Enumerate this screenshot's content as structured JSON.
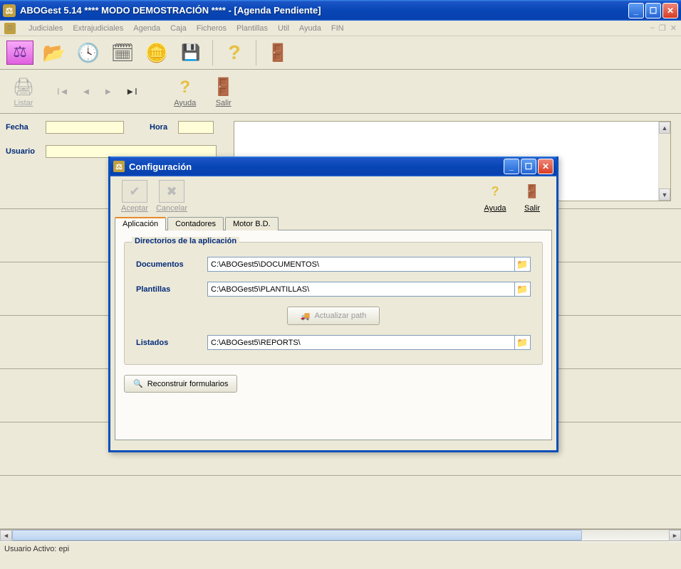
{
  "window": {
    "title": "ABOGest 5.14 **** MODO DEMOSTRACIÓN ****  - [Agenda Pendiente]"
  },
  "menu": {
    "items": [
      "Judiciales",
      "Extrajudiciales",
      "Agenda",
      "Caja",
      "Ficheros",
      "Plantillas",
      "Util",
      "Ayuda",
      "FIN"
    ]
  },
  "subtoolbar": {
    "listar": "Listar",
    "ayuda": "Ayuda",
    "salir": "Salir"
  },
  "form": {
    "fecha_label": "Fecha",
    "hora_label": "Hora",
    "usuario_label": "Usuario",
    "fecha_value": "",
    "hora_value": "",
    "usuario_value": ""
  },
  "statusbar": {
    "text": "Usuario Activo: epi"
  },
  "dialog": {
    "title": "Configuración",
    "toolbar": {
      "aceptar": "Aceptar",
      "cancelar": "Cancelar",
      "ayuda": "Ayuda",
      "salir": "Salir"
    },
    "tabs": [
      "Aplicación",
      "Contadores",
      "Motor B.D."
    ],
    "group_title": "Directorios de la aplicación",
    "rows": {
      "documentos_label": "Documentos",
      "documentos_value": "C:\\ABOGest5\\DOCUMENTOS\\",
      "plantillas_label": "Plantillas",
      "plantillas_value": "C:\\ABOGest5\\PLANTILLAS\\",
      "listados_label": "Listados",
      "listados_value": "C:\\ABOGest5\\REPORTS\\"
    },
    "actualizar": "Actualizar path",
    "reconstruir": "Reconstruir formularios"
  }
}
